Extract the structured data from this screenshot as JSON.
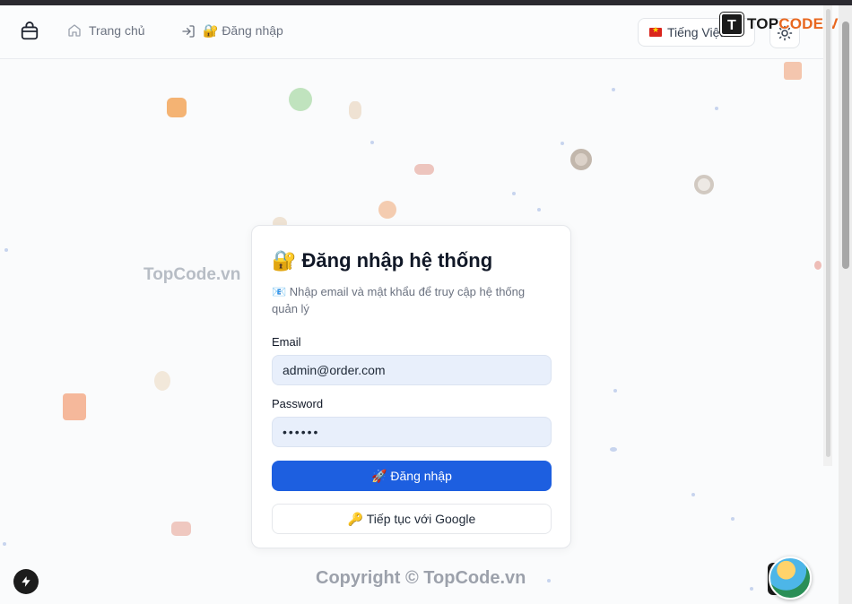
{
  "header": {
    "home_label": "Trang chủ",
    "login_label": "🔐 Đăng nhập",
    "language": "Tiếng Việt",
    "brand": {
      "mark": "T",
      "prefix": "TOP",
      "suffix": "CODE.VN"
    }
  },
  "watermarks": {
    "left": "TopCode.vn",
    "bottom": "Copyright © TopCode.vn"
  },
  "login_card": {
    "title": "🔐 Đăng nhập hệ thống",
    "description": "📧 Nhập email và mật khẩu để truy cập hệ thống quản lý",
    "email_label": "Email",
    "email_value": "admin@order.com",
    "password_label": "Password",
    "password_value": "••••••",
    "submit_label": "🚀 Đăng nhập",
    "google_label": "🔑 Tiếp tục với Google"
  },
  "colors": {
    "primary": "#1d5fe0",
    "input_bg": "#e8effb"
  }
}
